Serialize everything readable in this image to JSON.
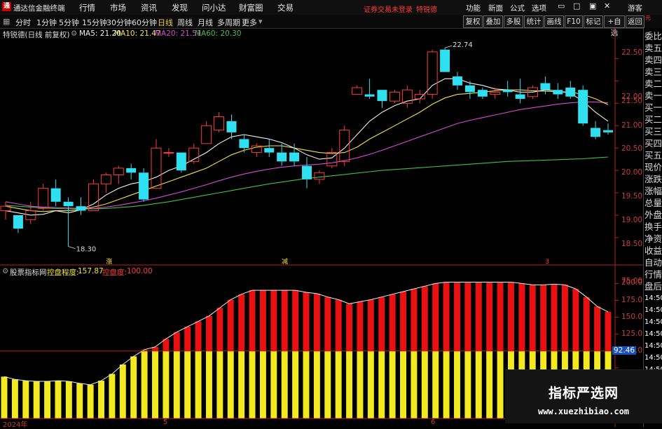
{
  "colors": {
    "up": "#ff3b3b",
    "down": "#2fe0f0",
    "ma5": "#f0f0f0",
    "ma10": "#f2e24a",
    "ma20": "#d64ad6",
    "ma60": "#43c043",
    "axis": "#b42020",
    "ctrl_red": "#e81010",
    "ctrl_yellow": "#f2ea1e"
  },
  "menubar": {
    "app_title": "通达信金融终端",
    "items": [
      "行情",
      "市场",
      "资讯",
      "发现",
      "问小达",
      "财富圈",
      "交易"
    ],
    "alert": "证券交易未登录",
    "stock_name": "特锐德",
    "right_items": [
      "功能",
      "新面",
      "公式",
      "选项"
    ],
    "guest": "游客"
  },
  "toolbar": {
    "periods": [
      "分时",
      "1分钟",
      "5分钟",
      "15分钟",
      "30分钟",
      "60分钟",
      "日线",
      "周线",
      "月线",
      "多周期",
      "更多"
    ],
    "active_period": "日线",
    "buttons": [
      "复权",
      "叠加",
      "多股",
      "统计",
      "画线",
      "F10",
      "标记",
      "+自选",
      "返回"
    ]
  },
  "infobar": {
    "title": "特锐德(日线 前复权)",
    "ma5": "MA5: 21.20",
    "ma10": "MA10: 21.47",
    "ma20": "MA20: 21.51",
    "ma60": "MA60: 20.30"
  },
  "price_axis": {
    "ticks": [
      "22.50",
      "22.00",
      "21.50",
      "21.00",
      "20.50",
      "20.00",
      "19.50",
      "19.00",
      "18.50"
    ],
    "top_marker": "元"
  },
  "annotations": {
    "high": "22.74",
    "low": "18.30",
    "marker_a": "涨",
    "marker_b": "减",
    "marker_c": "3"
  },
  "indicator": {
    "name": "股票指标网",
    "label": "控盘程度:",
    "value": "157.87",
    "label2": "控盘度:",
    "value2": "100.00",
    "ticks": [
      "200.0",
      "175.0",
      "150.0",
      "125.0",
      "100.0",
      "75.00"
    ],
    "marker": "92.46"
  },
  "x_axis": {
    "labels": [
      "2024年",
      "5",
      "6"
    ]
  },
  "right_panel": {
    "items": [
      "委比",
      "卖五",
      "卖四",
      "卖三",
      "卖二",
      "卖一",
      "买一",
      "买二",
      "买三",
      "买四",
      "买五",
      "现价",
      "涨跌",
      "涨幅",
      "总量",
      "外盘",
      "换手",
      "净资",
      "收益",
      "自动",
      "行情",
      "盘后",
      "14:50",
      "14:50",
      "14:50",
      "14:50",
      "14:50",
      "14:50",
      "14:50",
      "14:50"
    ]
  },
  "watermark": {
    "title": "指标严选网",
    "url": "www.xuezhibiao.com"
  },
  "chart_data": [
    {
      "type": "candlestick",
      "title": "特锐德(日线 前复权)",
      "ylim": [
        18.2,
        22.9
      ],
      "y_ticks": [
        18.5,
        19.0,
        19.5,
        20.0,
        20.5,
        21.0,
        21.5,
        22.0,
        22.5
      ],
      "candles": [
        [
          19.1,
          19.3,
          18.9,
          19.2
        ],
        [
          19.0,
          19.0,
          18.6,
          18.7
        ],
        [
          18.9,
          19.3,
          18.8,
          19.1
        ],
        [
          19.15,
          19.7,
          19.1,
          19.6
        ],
        [
          19.6,
          19.8,
          19.2,
          19.3
        ],
        [
          19.3,
          19.4,
          18.3,
          19.2
        ],
        [
          19.2,
          19.4,
          19.0,
          19.1
        ],
        [
          19.1,
          19.8,
          19.1,
          19.7
        ],
        [
          19.7,
          19.95,
          19.5,
          19.9
        ],
        [
          19.9,
          20.1,
          19.7,
          20.05
        ],
        [
          20.05,
          20.15,
          19.8,
          19.95
        ],
        [
          19.95,
          20.05,
          19.3,
          19.35
        ],
        [
          19.6,
          20.7,
          19.6,
          20.5
        ],
        [
          20.4,
          20.5,
          20.3,
          20.4
        ],
        [
          20.4,
          20.4,
          19.95,
          20.0
        ],
        [
          20.2,
          20.6,
          20.15,
          20.5
        ],
        [
          20.6,
          21.1,
          20.6,
          21.0
        ],
        [
          20.9,
          21.3,
          20.85,
          21.2
        ],
        [
          21.1,
          21.25,
          20.7,
          20.85
        ],
        [
          20.7,
          20.8,
          20.4,
          20.5
        ],
        [
          20.4,
          20.6,
          20.3,
          20.55
        ],
        [
          20.5,
          20.7,
          20.3,
          20.4
        ],
        [
          20.4,
          20.6,
          20.1,
          20.2
        ],
        [
          20.4,
          20.6,
          20.1,
          20.2
        ],
        [
          20.1,
          20.3,
          19.6,
          19.8
        ],
        [
          19.8,
          20.0,
          19.7,
          19.95
        ],
        [
          20.1,
          20.5,
          20.05,
          20.4
        ],
        [
          20.2,
          21.0,
          20.1,
          20.9
        ],
        [
          21.7,
          21.9,
          21.7,
          21.85
        ],
        [
          21.7,
          22.05,
          21.6,
          21.65
        ],
        [
          21.8,
          21.8,
          21.4,
          21.55
        ],
        [
          21.55,
          21.8,
          21.5,
          21.75
        ],
        [
          21.5,
          21.9,
          21.4,
          21.8
        ],
        [
          21.6,
          21.8,
          21.5,
          21.7
        ],
        [
          21.7,
          22.7,
          21.6,
          22.65
        ],
        [
          22.7,
          22.74,
          22.2,
          22.2
        ],
        [
          22.1,
          22.2,
          21.8,
          21.9
        ],
        [
          21.9,
          22.0,
          21.6,
          21.75
        ],
        [
          21.8,
          21.85,
          21.6,
          21.65
        ],
        [
          21.7,
          21.85,
          21.6,
          21.75
        ],
        [
          21.8,
          22.0,
          21.65,
          21.75
        ],
        [
          21.7,
          22.05,
          21.5,
          21.6
        ],
        [
          21.65,
          21.9,
          21.6,
          21.85
        ],
        [
          21.95,
          22.1,
          21.7,
          21.8
        ],
        [
          21.8,
          21.95,
          21.6,
          21.7
        ],
        [
          21.85,
          22.0,
          21.6,
          21.65
        ],
        [
          21.8,
          21.9,
          21.0,
          21.05
        ],
        [
          20.95,
          21.1,
          20.7,
          20.75
        ],
        [
          20.9,
          21.05,
          20.8,
          20.85
        ]
      ],
      "ma5": [
        19.1,
        19.05,
        19.0,
        19.02,
        19.1,
        19.05,
        19.12,
        19.25,
        19.45,
        19.6,
        19.7,
        19.75,
        19.85,
        20.0,
        20.1,
        20.25,
        20.4,
        20.6,
        20.75,
        20.8,
        20.75,
        20.7,
        20.62,
        20.5,
        20.35,
        20.25,
        20.28,
        20.5,
        20.8,
        21.1,
        21.3,
        21.45,
        21.55,
        21.6,
        21.9,
        22.05,
        22.05,
        21.95,
        21.9,
        21.82,
        21.8,
        21.75,
        21.75,
        21.8,
        21.78,
        21.72,
        21.55,
        21.3,
        21.1
      ],
      "ma10": [
        19.2,
        19.15,
        19.1,
        19.08,
        19.1,
        19.1,
        19.12,
        19.18,
        19.25,
        19.35,
        19.45,
        19.55,
        19.65,
        19.75,
        19.85,
        19.95,
        20.05,
        20.2,
        20.35,
        20.45,
        20.52,
        20.55,
        20.55,
        20.5,
        20.45,
        20.4,
        20.38,
        20.4,
        20.52,
        20.7,
        20.85,
        21.0,
        21.15,
        21.3,
        21.48,
        21.62,
        21.7,
        21.72,
        21.75,
        21.78,
        21.8,
        21.8,
        21.78,
        21.77,
        21.76,
        21.75,
        21.7,
        21.6,
        21.47
      ],
      "ma20": [
        19.3,
        19.25,
        19.2,
        19.18,
        19.17,
        19.16,
        19.15,
        19.15,
        19.18,
        19.22,
        19.27,
        19.32,
        19.38,
        19.45,
        19.52,
        19.6,
        19.68,
        19.77,
        19.85,
        19.92,
        19.98,
        20.03,
        20.07,
        20.1,
        20.12,
        20.14,
        20.17,
        20.22,
        20.28,
        20.36,
        20.45,
        20.55,
        20.65,
        20.75,
        20.85,
        20.95,
        21.05,
        21.12,
        21.18,
        21.24,
        21.3,
        21.36,
        21.4,
        21.44,
        21.48,
        21.51,
        21.53,
        21.53,
        21.51
      ],
      "ma60": [
        19.22,
        19.2,
        19.18,
        19.16,
        19.15,
        19.14,
        19.14,
        19.14,
        19.15,
        19.17,
        19.19,
        19.22,
        19.26,
        19.3,
        19.35,
        19.4,
        19.45,
        19.5,
        19.55,
        19.6,
        19.65,
        19.7,
        19.74,
        19.78,
        19.82,
        19.85,
        19.88,
        19.91,
        19.94,
        19.97,
        20.0,
        20.02,
        20.04,
        20.06,
        20.08,
        20.1,
        20.12,
        20.14,
        20.16,
        20.18,
        20.2,
        20.21,
        20.22,
        20.23,
        20.24,
        20.25,
        20.26,
        20.28,
        20.3
      ]
    },
    {
      "type": "bar",
      "title": "控盘程度",
      "ylim": [
        0,
        215
      ],
      "y_ticks": [
        75,
        100,
        125,
        150,
        175,
        200
      ],
      "threshold": 100,
      "values": [
        62,
        58,
        56,
        55,
        55,
        56,
        55,
        52,
        50,
        56,
        66,
        80,
        92,
        102,
        106,
        118,
        128,
        136,
        144,
        152,
        164,
        176,
        184,
        190,
        190,
        190,
        190,
        190,
        187,
        185,
        180,
        176,
        170,
        173,
        176,
        180,
        184,
        188,
        192,
        196,
        200,
        202,
        202,
        202,
        202,
        202,
        202,
        202,
        200,
        198,
        198,
        199,
        198,
        192,
        180,
        166,
        158
      ]
    }
  ]
}
